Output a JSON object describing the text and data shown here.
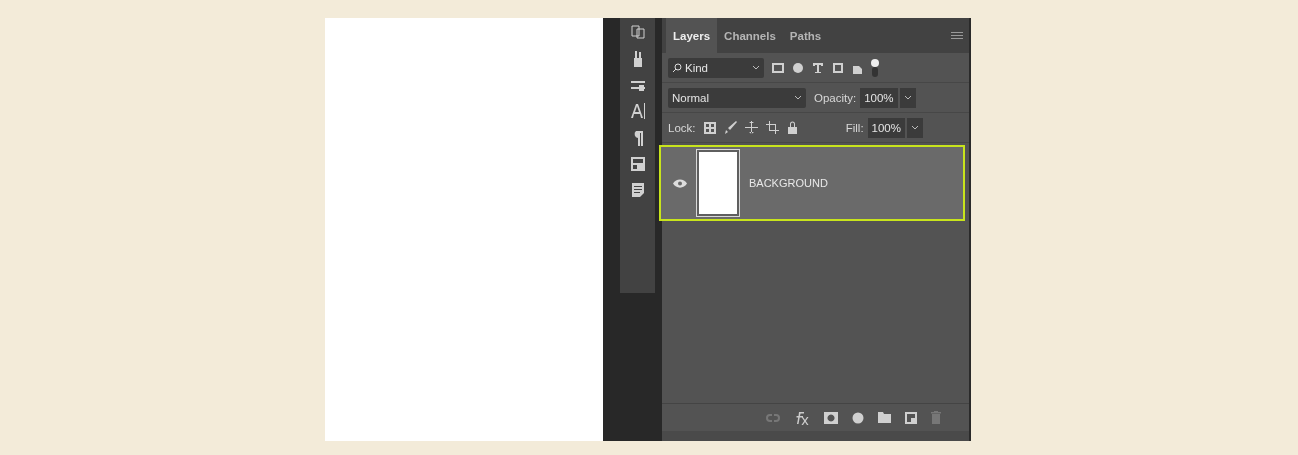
{
  "tabs": [
    {
      "label": "Layers",
      "selected": true
    },
    {
      "label": "Channels",
      "selected": false
    },
    {
      "label": "Paths",
      "selected": false
    }
  ],
  "filter": {
    "value": "Kind"
  },
  "blend_mode": {
    "value": "Normal"
  },
  "opacity": {
    "label": "Opacity:",
    "value": "100%"
  },
  "lock": {
    "label": "Lock:"
  },
  "fill": {
    "label": "Fill:",
    "value": "100%"
  },
  "layers": [
    {
      "name": "BACKGROUND",
      "visible": true,
      "selected": true
    }
  ]
}
